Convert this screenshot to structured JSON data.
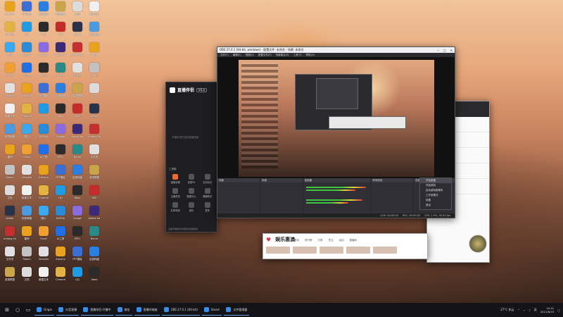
{
  "desktop_icons": [
    {
      "label": "Arduino",
      "color": "#e8a21c"
    },
    {
      "label": "PPT模板",
      "color": "#3b6fd6"
    },
    {
      "label": "百度网盘",
      "color": "#2a7fe0"
    },
    {
      "label": "英雄联盟",
      "color": "#c9a44a"
    },
    {
      "label": "文档",
      "color": "#dcdcdc"
    },
    {
      "label": "新建文本",
      "color": "#f0f0f0"
    },
    {
      "label": "Chrome",
      "color": "#e3b341"
    },
    {
      "label": "QQ",
      "color": "#1f9be6"
    },
    {
      "label": "Xbox",
      "color": "#2b2b2b"
    },
    {
      "label": "MSI",
      "color": "#c42b2b"
    },
    {
      "label": "steam",
      "color": "#28324a"
    },
    {
      "label": "网易邮箱",
      "color": "#4a9be0"
    },
    {
      "label": "图片",
      "color": "#3ca8f0"
    },
    {
      "label": "NVIDIA",
      "color": "#2a8cd8"
    },
    {
      "label": "Google",
      "color": "#8a6be0"
    },
    {
      "label": "Adobe Ae",
      "color": "#3b2a7a"
    },
    {
      "label": "Among Us",
      "color": "#c43030"
    },
    {
      "label": "雷神",
      "color": "#e8a21c"
    },
    {
      "label": "Excel",
      "color": "#f0a030"
    },
    {
      "label": "AI工具",
      "color": "#1f6fe8"
    },
    {
      "label": "EPIC",
      "color": "#2b2b2b"
    },
    {
      "label": "Nerve",
      "color": "#2a8a8a"
    },
    {
      "label": "文件夹",
      "color": "#e0e0e0"
    },
    {
      "label": "Steam",
      "color": "#c2c2c2"
    },
    {
      "label": "Genshin",
      "color": "#e0e0e0"
    }
  ],
  "windows": {
    "obs": {
      "title": "OBS 27.0.1 (64-bit, windows) - 配置文件: 未命名 - 场景: 未命名",
      "menus": [
        "文件(F)",
        "编辑(E)",
        "视图(V)",
        "配置文件(P)",
        "场景集合(S)",
        "工具(T)",
        "帮助(H)"
      ],
      "docks": [
        "场景",
        "来源",
        "混音器",
        "转场特效",
        "控制"
      ],
      "status": [
        "LIVE: 00:00:00",
        "REC: 00:00:00",
        "CPU: 1.9%, 30.00 fps"
      ]
    },
    "helper": {
      "brand": "直播伴侣",
      "version": "V3.4",
      "hint": "开播前请先选择直播场景",
      "section": "工具箱",
      "tools": [
        "直播设置",
        "连麦PK",
        "互动玩法",
        "主播任务",
        "数据中心",
        "弹幕助手",
        "礼物特效",
        "音乐",
        "更多"
      ],
      "footer": "主播开播前请仔细阅读直播规范"
    },
    "context_menu": [
      "开始直播",
      "开始录制",
      "启动虚拟摄像机",
      "工作室模式",
      "设置",
      "退出"
    ],
    "browser": {
      "title": "娱乐惠澳",
      "nav": [
        "首页",
        "排行榜",
        "分类",
        "关注",
        "活动",
        "直播间"
      ]
    },
    "chat_rows": [
      "已关注主播",
      "粉丝团成员",
      "直播间好友",
      "欢迎回来",
      "新消息"
    ]
  },
  "taskbar": {
    "apps": [
      "Origin",
      "抖音直播",
      "直播伴侣-开播中",
      "微信",
      "直播间电脑",
      "OBS 27.0.1 (64-bit)",
      "Steam",
      "文件管理器"
    ],
    "tray_temp": "27°C 多云",
    "ime": "英",
    "time": "10:41",
    "date": "2021/8/19"
  }
}
